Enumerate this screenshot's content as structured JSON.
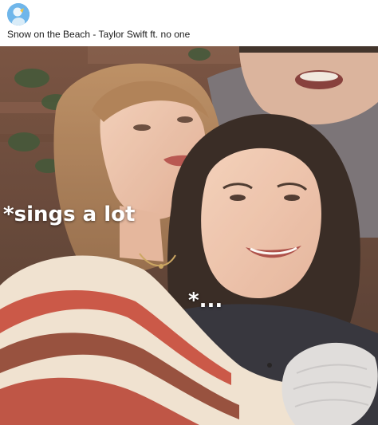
{
  "post": {
    "caption": "Snow on the Beach - Taylor Swift ft. no one",
    "avatar_icon": "avatar-icon"
  },
  "image": {
    "overlay_top": "*sings a lot",
    "overlay_bottom": "*..."
  }
}
